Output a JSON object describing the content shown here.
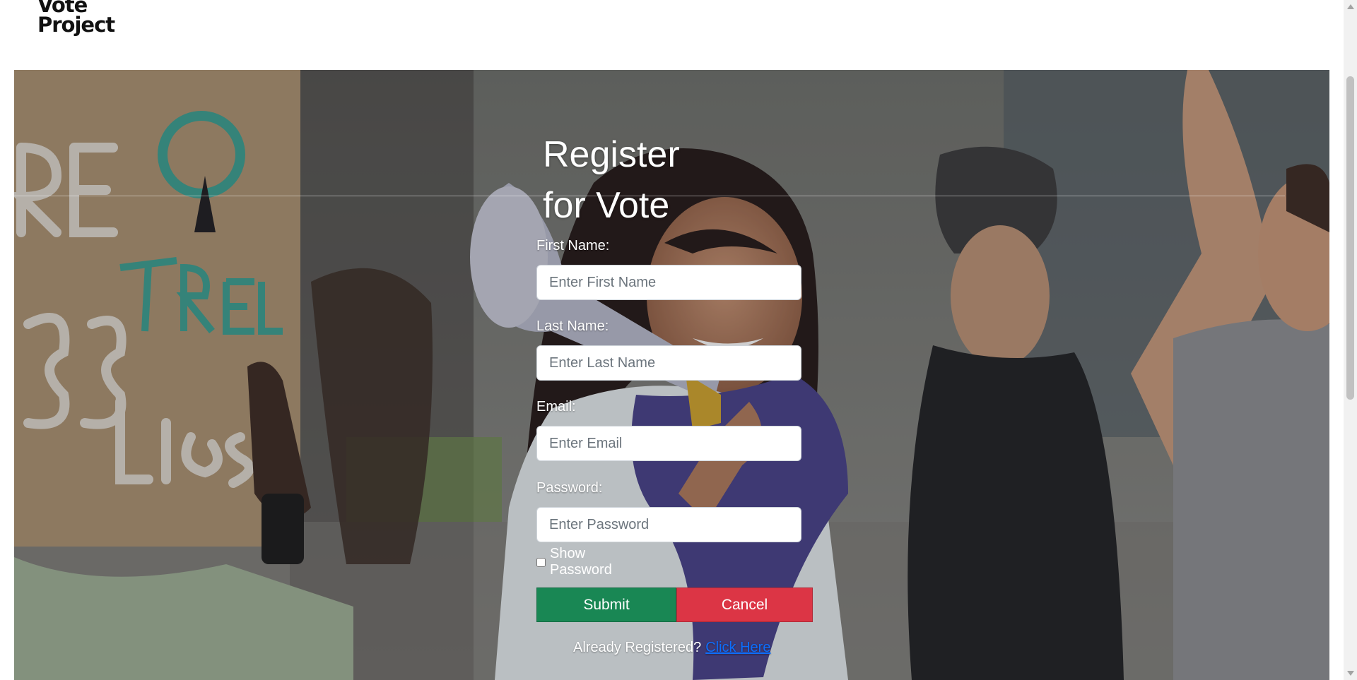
{
  "brand": {
    "line1": "Vote",
    "line2": "Project"
  },
  "form": {
    "title": "Register for Vote",
    "first_name": {
      "label": "First Name:",
      "placeholder": "Enter First Name",
      "value": ""
    },
    "last_name": {
      "label": "Last Name:",
      "placeholder": "Enter Last Name",
      "value": ""
    },
    "email": {
      "label": "Email:",
      "placeholder": "Enter Email",
      "value": ""
    },
    "password": {
      "label": "Password:",
      "placeholder": "Enter Password",
      "value": ""
    },
    "show_password": {
      "label": "Show Password",
      "checked": false
    },
    "submit_label": "Submit",
    "cancel_label": "Cancel",
    "already_text": "Already Registered?",
    "login_link": "Click Here"
  },
  "colors": {
    "submit": "#198754",
    "cancel": "#dc3545",
    "link": "#0d6efd"
  }
}
